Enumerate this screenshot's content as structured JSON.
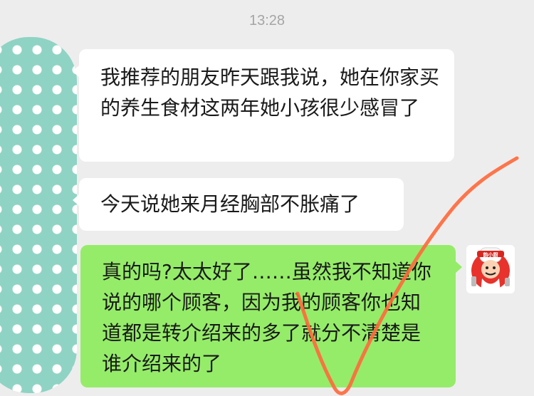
{
  "timestamp": "13:28",
  "messages": [
    {
      "side": "incoming",
      "text": "我推荐的朋友昨天跟我说，她在你家买的养生食材这两年她小孩很少感冒了"
    },
    {
      "side": "incoming",
      "text": "今天说她来月经胸部不胀痛了"
    },
    {
      "side": "outgoing",
      "text": "真的吗?太太好了……虽然我不知道你说的哪个顾客，因为我的顾客你也知道都是转介绍来的多了就分不清楚是谁介绍来的了"
    }
  ],
  "avatars": {
    "left": {
      "icon": "polka-dot-avatar-icon",
      "color": "#8fd3c4"
    },
    "right": {
      "icon": "chef-cartoon-avatar-icon",
      "label": "韵小厨"
    }
  },
  "annotation": {
    "icon": "checkmark-icon",
    "color": "#ff6a3d"
  },
  "colors": {
    "background": "#ededed",
    "incoming_bubble": "#ffffff",
    "outgoing_bubble": "#95ec69"
  }
}
